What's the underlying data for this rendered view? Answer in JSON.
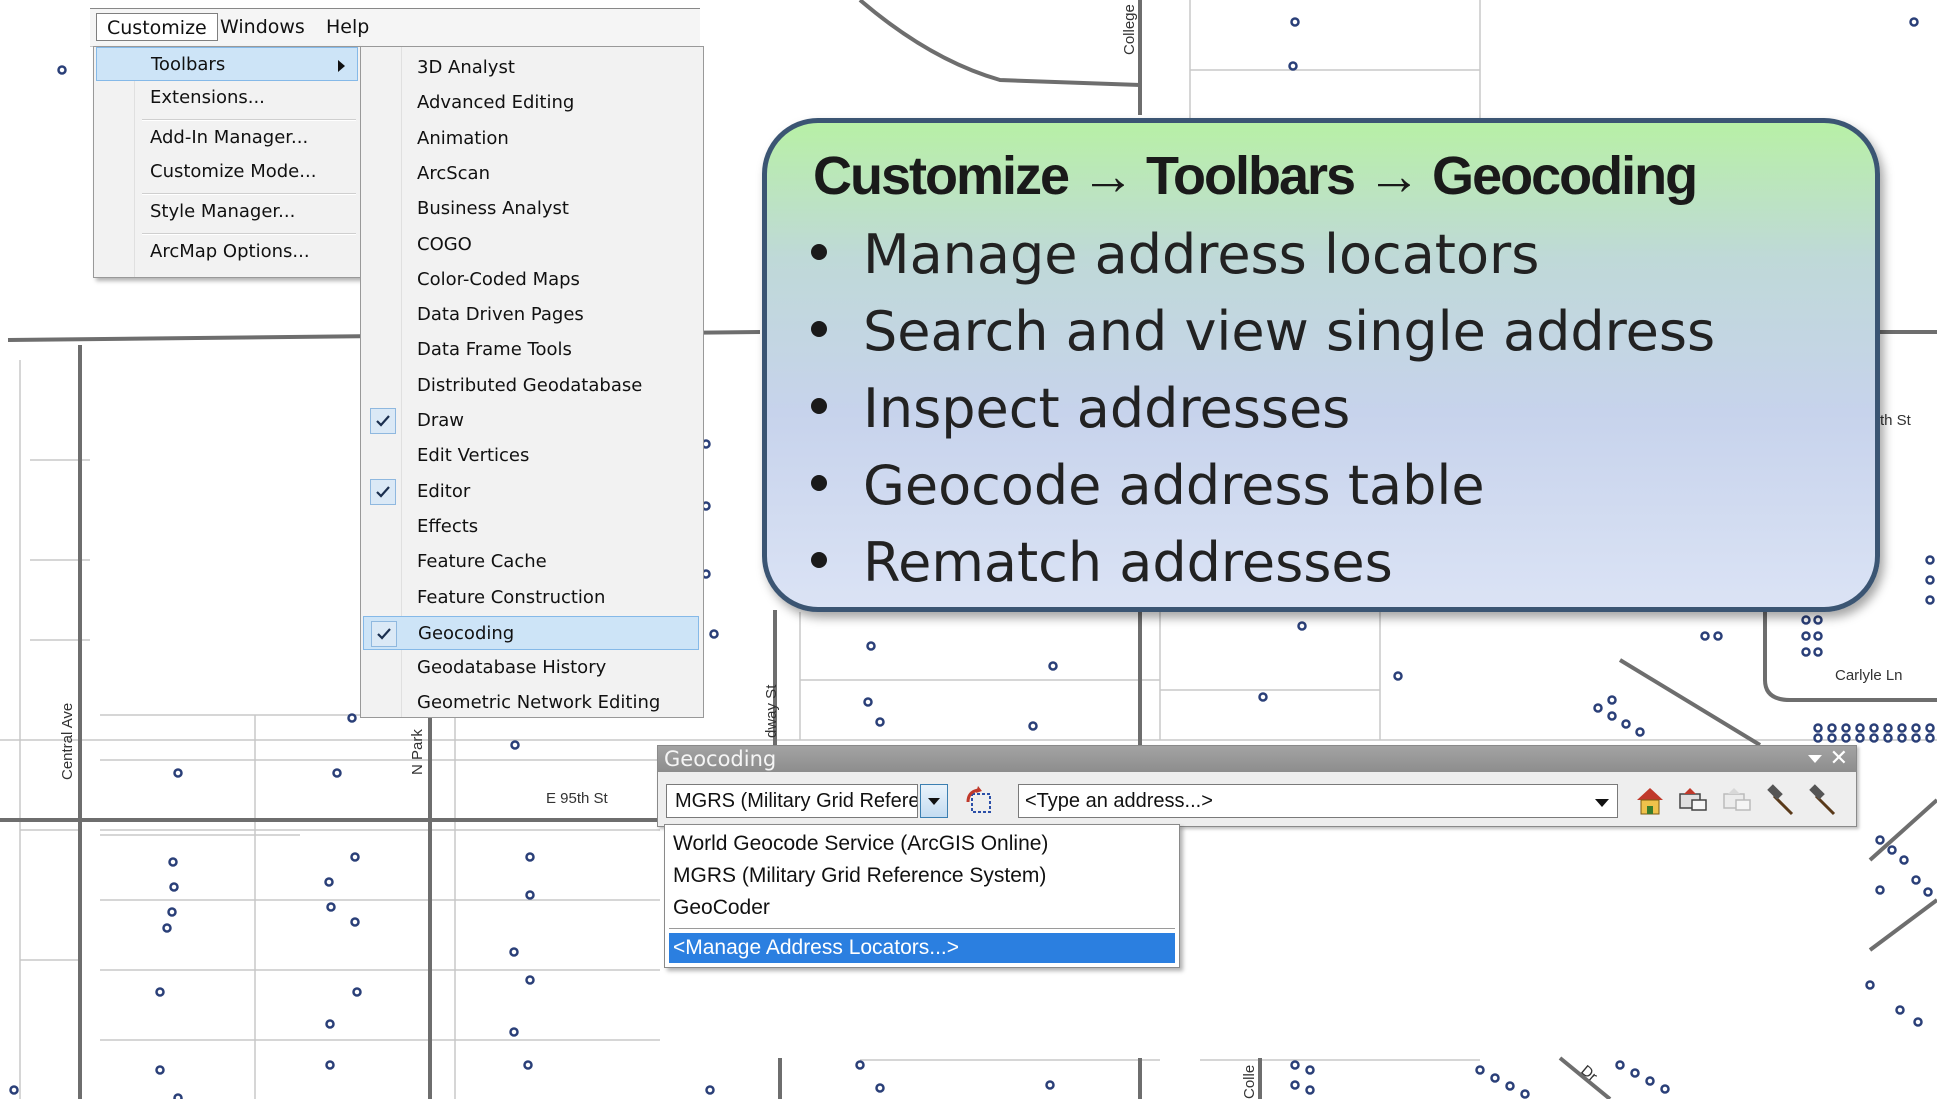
{
  "map": {
    "street_labels": [
      "College",
      "Central Ave",
      "N Park",
      "E 95th St",
      "dway St",
      "Carlyle Ln",
      "th St",
      "Colle",
      "Dr"
    ]
  },
  "menubar": {
    "items": [
      "Customize",
      "Windows",
      "Help"
    ]
  },
  "customize_menu": {
    "items": [
      "Toolbars",
      "Extensions...",
      "Add-In Manager...",
      "Customize Mode...",
      "Style Manager...",
      "ArcMap Options..."
    ]
  },
  "toolbars_submenu": {
    "items": [
      {
        "label": "3D Analyst",
        "checked": false
      },
      {
        "label": "Advanced Editing",
        "checked": false
      },
      {
        "label": "Animation",
        "checked": false
      },
      {
        "label": "ArcScan",
        "checked": false
      },
      {
        "label": "Business Analyst",
        "checked": false
      },
      {
        "label": "COGO",
        "checked": false
      },
      {
        "label": "Color-Coded Maps",
        "checked": false
      },
      {
        "label": "Data Driven Pages",
        "checked": false
      },
      {
        "label": "Data Frame Tools",
        "checked": false
      },
      {
        "label": "Distributed Geodatabase",
        "checked": false
      },
      {
        "label": "Draw",
        "checked": true
      },
      {
        "label": "Edit Vertices",
        "checked": false
      },
      {
        "label": "Editor",
        "checked": true
      },
      {
        "label": "Effects",
        "checked": false
      },
      {
        "label": "Feature Cache",
        "checked": false
      },
      {
        "label": "Feature Construction",
        "checked": false
      },
      {
        "label": "Geocoding",
        "checked": true
      },
      {
        "label": "Geodatabase History",
        "checked": false
      },
      {
        "label": "Geometric Network Editing",
        "checked": false
      }
    ]
  },
  "callout": {
    "title": "Customize → Toolbars → Geocoding",
    "bullets": [
      "Manage address locators",
      "Search and view single address",
      "Inspect addresses",
      "Geocode address table",
      "Rematch addresses"
    ]
  },
  "geocoding_toolbar": {
    "title": "Geocoding",
    "close_glyph": "✕",
    "locator_value": "MGRS (Military Grid Reference System)",
    "address_placeholder": "<Type an address...>",
    "locator_options": [
      "World Geocode Service (ArcGIS Online)",
      "MGRS (Military Grid Reference System)",
      "GeoCoder",
      "<Manage Address Locators...>"
    ]
  },
  "colors": {
    "menu_highlight": "#cde4f7",
    "dropdown_highlight": "#2b7fe0",
    "callout_border": "#3b5573",
    "map_point": "#2a3f78"
  }
}
